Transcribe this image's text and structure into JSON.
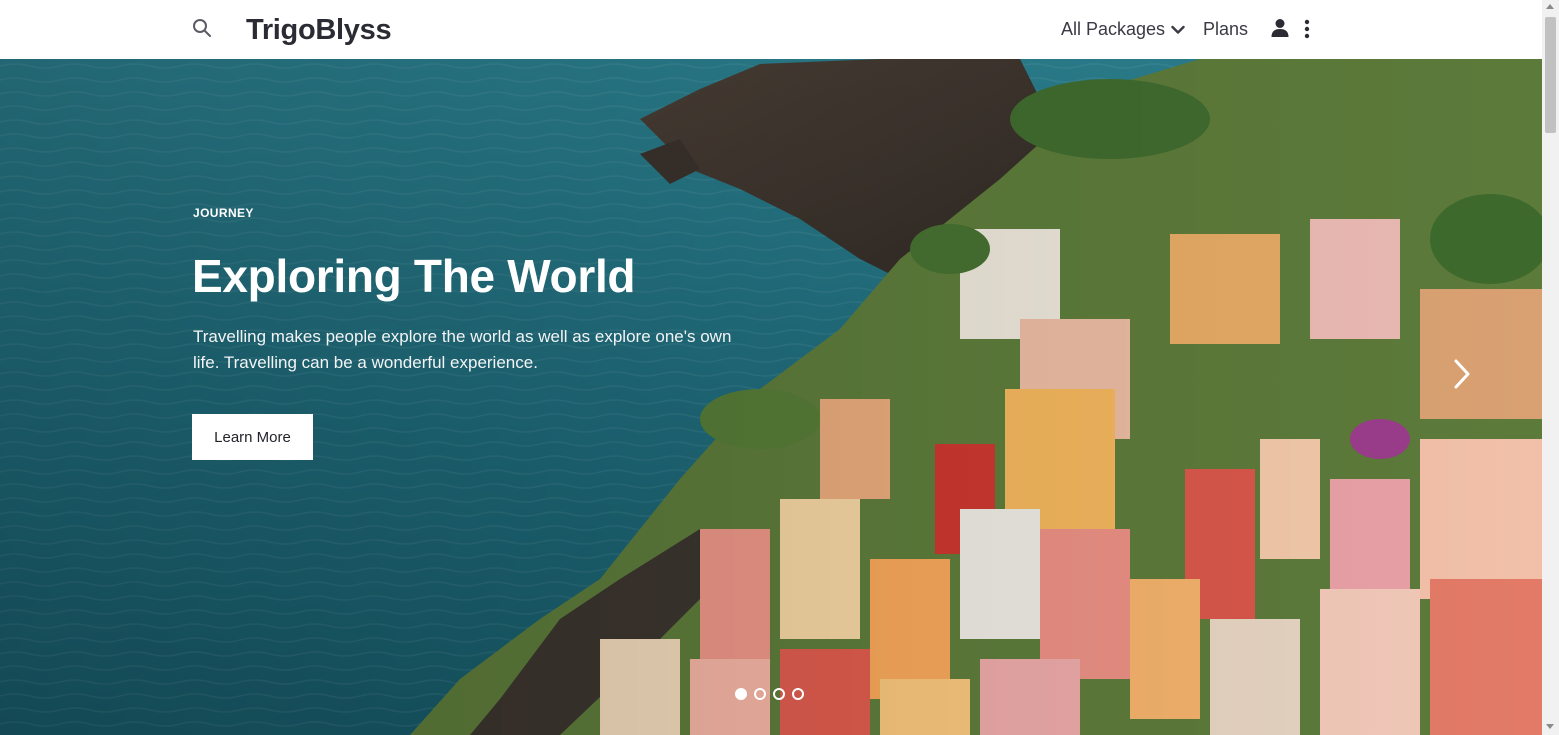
{
  "header": {
    "brand": "TrigoBlyss",
    "search_icon": "search-icon",
    "nav": {
      "all_packages": "All Packages",
      "plans": "Plans"
    },
    "user_icon": "user-icon",
    "more_icon": "vertical-dots-icon"
  },
  "hero": {
    "kicker": "JOURNEY",
    "title": "Exploring The World",
    "text": "Travelling makes people explore the world as well as explore one's own life. Travelling can be a wonderful experience.",
    "cta_label": "Learn More",
    "slides_total": 4,
    "active_slide": 1,
    "next_icon": "chevron-right-icon"
  },
  "colors": {
    "brand_text": "#2b2b33",
    "sea": "#1f6a7a",
    "button_bg": "#ffffff"
  }
}
